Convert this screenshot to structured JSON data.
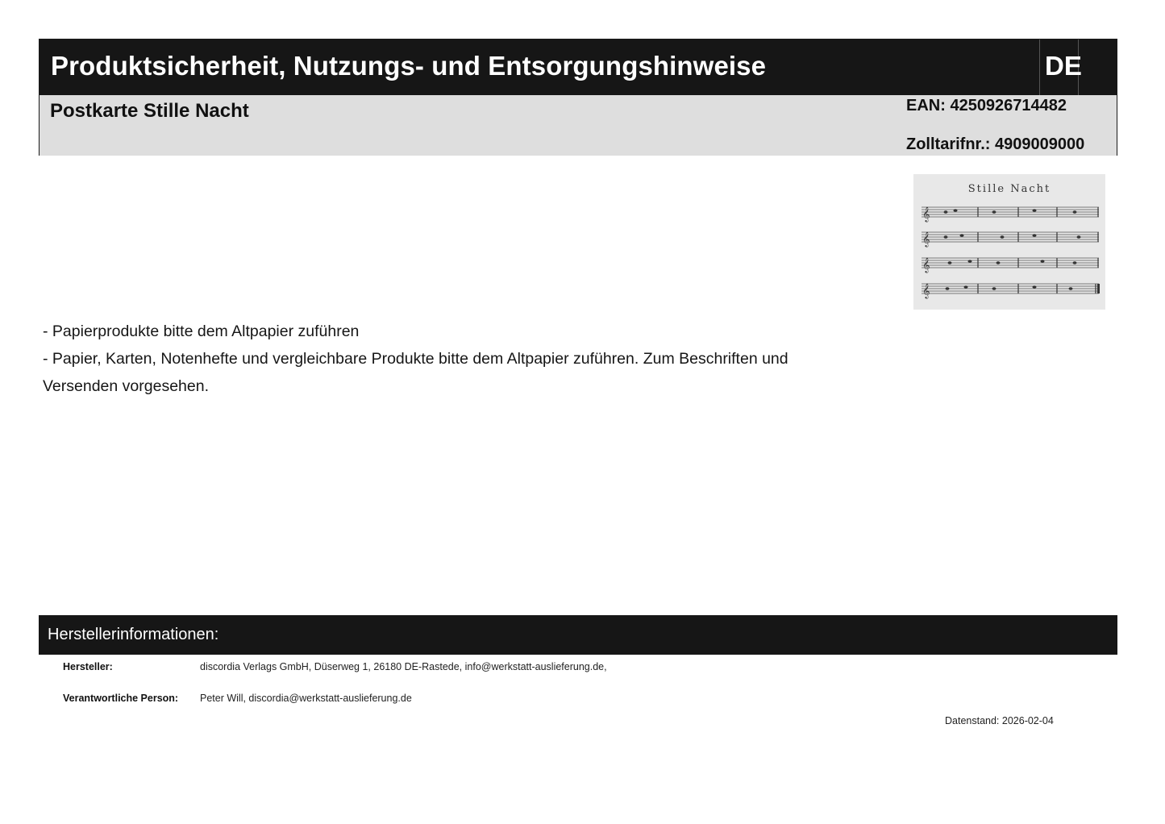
{
  "header": {
    "title": "Produktsicherheit, Nutzungs- und Entsorgungshinweise",
    "language": "DE",
    "product_name": "Postkarte Stille Nacht",
    "ean": "EAN: 4250926714482",
    "customs_tariff": "Zolltarifnr.: 4909009000"
  },
  "product_image": {
    "caption": "Stille Nacht",
    "icon": "sheet-music-image"
  },
  "hints": {
    "lines": [
      "- Papierprodukte bitte dem Altpapier zuführen",
      "- Papier, Karten, Notenhefte und vergleichbare Produkte bitte dem Altpapier zuführen. Zum Beschriften und Versenden vorgesehen."
    ]
  },
  "manufacturer": {
    "section_title": "Herstellerinformationen:",
    "manufacturer_label": "Hersteller:",
    "manufacturer_value": "discordia Verlags GmbH, Düserweg 1, 26180 DE-Rastede, info@werkstatt-auslieferung.de,",
    "responsible_label": "Verantwortliche Person:",
    "responsible_value": "Peter Will, discordia@werkstatt-auslieferung.de"
  },
  "footer": {
    "date": "Datenstand: 2026-02-04"
  },
  "colors": {
    "header_bg": "#161616",
    "info_bg": "#dedede",
    "text": "#111111"
  }
}
